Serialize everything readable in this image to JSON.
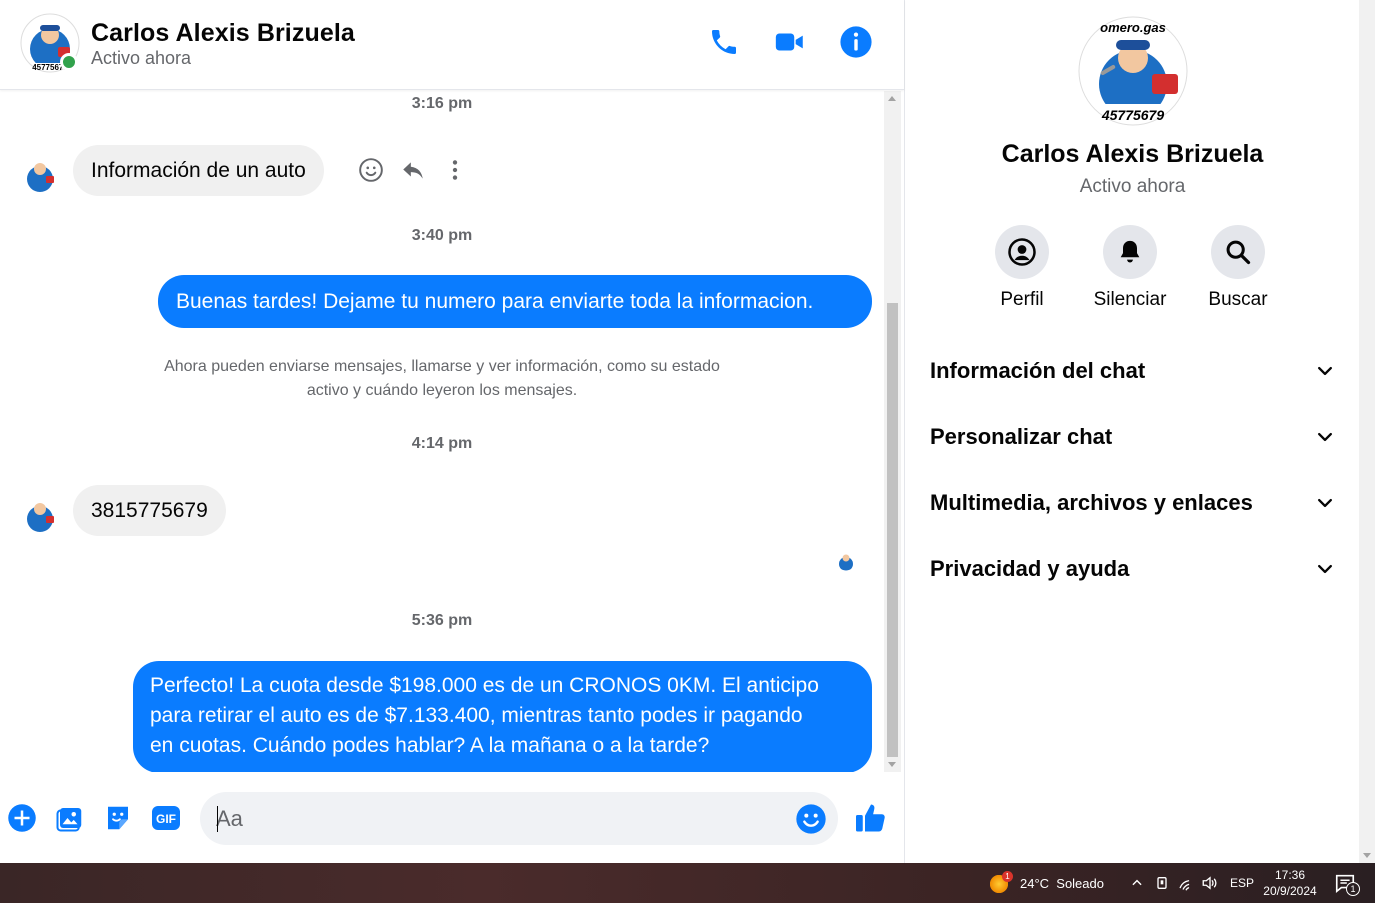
{
  "header": {
    "name": "Carlos Alexis Brizuela",
    "status": "Activo ahora",
    "avatar_caption": "45775679"
  },
  "messages": [
    {
      "kind": "time",
      "text": "3:16 pm"
    },
    {
      "kind": "in",
      "text": "Información de un auto"
    },
    {
      "kind": "time",
      "text": "3:40 pm"
    },
    {
      "kind": "out",
      "text": "Buenas tardes! Dejame tu numero para enviarte toda la informacion."
    },
    {
      "kind": "system",
      "line1": "Ahora pueden enviarse mensajes, llamarse y ver información, como su estado",
      "line2": "activo y cuándo leyeron los mensajes."
    },
    {
      "kind": "time",
      "text": "4:14 pm"
    },
    {
      "kind": "in",
      "text": "3815775679"
    },
    {
      "kind": "time",
      "text": "5:36 pm"
    },
    {
      "kind": "out",
      "lines": [
        "Perfecto! La cuota desde $198.000 es de un CRONOS 0KM. El anticipo",
        "para retirar el auto es de $7.133.400, mientras tanto podes ir pagando",
        "en cuotas. Cuándo podes hablar? A la mañana o a la tarde?"
      ]
    }
  ],
  "composer": {
    "placeholder": "Aa",
    "gif_label": "GIF"
  },
  "info_panel": {
    "avatar_top_text": "omero.gas",
    "avatar_caption": "45775679",
    "name": "Carlos Alexis Brizuela",
    "status": "Activo ahora",
    "actions": [
      {
        "label": "Perfil",
        "icon": "profile-icon"
      },
      {
        "label": "Silenciar",
        "icon": "bell-icon"
      },
      {
        "label": "Buscar",
        "icon": "search-icon"
      }
    ],
    "sections": [
      {
        "label": "Información del chat"
      },
      {
        "label": "Personalizar chat"
      },
      {
        "label": "Multimedia, archivos y enlaces"
      },
      {
        "label": "Privacidad y ayuda"
      }
    ]
  },
  "taskbar": {
    "weather_badge": "1",
    "weather": "24°C  Soleado",
    "lang": "ESP",
    "time": "17:36",
    "date": "20/9/2024",
    "notif_count": "1"
  },
  "colors": {
    "accent": "#0a7cff",
    "online": "#31a24c",
    "bubble_in": "#f0f0f0"
  }
}
